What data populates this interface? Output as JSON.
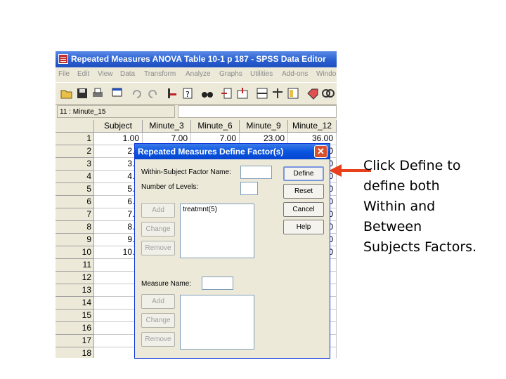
{
  "window": {
    "title": "Repeated Measures ANOVA Table 10-1 p 187 - SPSS Data Editor",
    "menu": [
      "File",
      "Edit",
      "View",
      "Data",
      "Transform",
      "Analyze",
      "Graphs",
      "Utilities",
      "Add-ons",
      "Windo"
    ],
    "toolbar_icons": [
      "open-icon",
      "save-icon",
      "print-icon",
      "dialog-recall-icon",
      "undo-icon",
      "redo-icon",
      "goto-case-icon",
      "variables-icon",
      "find-icon",
      "insert-case-icon",
      "insert-variable-icon",
      "split-file-icon",
      "weight-cases-icon",
      "select-cases-icon",
      "value-labels-icon",
      "use-sets-icon"
    ],
    "cell_reference": "11 : Minute_15",
    "cell_value": ""
  },
  "grid": {
    "columns": [
      "Subject",
      "Minute_3",
      "Minute_6",
      "Minute_9",
      "Minute_12"
    ],
    "row_numbers": [
      "1",
      "2",
      "3",
      "4",
      "5",
      "6",
      "7",
      "8",
      "9",
      "10",
      "11",
      "12",
      "13",
      "14",
      "15",
      "16",
      "17",
      "18"
    ],
    "rows": [
      [
        "1.00",
        "7.00",
        "7.00",
        "23.00",
        "36.00"
      ],
      [
        "2.0",
        "",
        "",
        "",
        "0"
      ],
      [
        "3.0",
        "",
        "",
        "",
        "0"
      ],
      [
        "4.0",
        "",
        "",
        "",
        "0"
      ],
      [
        "5.0",
        "",
        "",
        "",
        "0"
      ],
      [
        "6.0",
        "",
        "",
        "",
        "0"
      ],
      [
        "7.0",
        "",
        "",
        "",
        "0"
      ],
      [
        "8.0",
        "",
        "",
        "",
        "0"
      ],
      [
        "9.0",
        "",
        "",
        "",
        "0"
      ],
      [
        "10.0",
        "",
        "",
        "",
        "0"
      ]
    ]
  },
  "dialog": {
    "title": "Repeated Measures Define Factor(s)",
    "factor_name_label": "Within-Subject Factor Name:",
    "factor_name_value": "",
    "levels_label": "Number of Levels:",
    "levels_value": "",
    "factor_list": [
      "treatmnt(5)"
    ],
    "add_label": "Add",
    "change_label": "Change",
    "remove_label": "Remove",
    "define_label": "Define",
    "reset_label": "Reset",
    "cancel_label": "Cancel",
    "help_label": "Help",
    "measure_name_label": "Measure Name:",
    "measure_name_value": "",
    "measure_add_label": "Add",
    "measure_change_label": "Change",
    "measure_remove_label": "Remove",
    "close_glyph": "✕"
  },
  "annotation": {
    "text": "Click Define to\ndefine both\nWithin and\nBetween\nSubjects Factors.",
    "arrow_color": "#e8401c"
  }
}
